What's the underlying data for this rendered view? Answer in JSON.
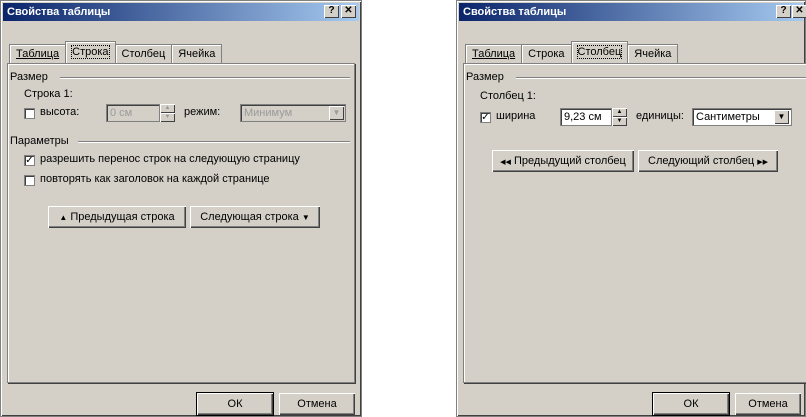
{
  "left": {
    "title": "Свойства таблицы",
    "help_label": "?",
    "close_label": "✕",
    "tabs": [
      "Таблица",
      "Строка",
      "Столбец",
      "Ячейка"
    ],
    "active_tab": "Строка",
    "size_group": "Размер",
    "row_label": "Строка 1:",
    "height_label": "высота:",
    "height_value": "0 см",
    "mode_label": "режим:",
    "mode_value": "Минимум",
    "params_group": "Параметры",
    "option_1": "разрешить перенос строк на следующую страницу",
    "option_1_checked": true,
    "option_2": "повторять как заголовок на каждой странице",
    "option_2_checked": false,
    "prev_button": "Предыдущая строка",
    "next_button": "Следующая строка",
    "prev_arrow": "▲",
    "next_arrow": "▼",
    "ok": "ОК",
    "cancel": "Отмена"
  },
  "right": {
    "title": "Свойства таблицы",
    "help_label": "?",
    "close_label": "✕",
    "tabs": [
      "Таблица",
      "Строка",
      "Столбец",
      "Ячейка"
    ],
    "active_tab": "Столбец",
    "size_group": "Размер",
    "col_label": "Столбец 1:",
    "width_label": "ширина",
    "width_checked": true,
    "width_value": "9,23 см",
    "units_label": "единицы:",
    "units_value": "Сантиметры",
    "prev_button": "Предыдущий столбец",
    "next_button": "Следующий столбец",
    "prev_arrow": "◀◀",
    "next_arrow": "▶▶",
    "ok": "ОК",
    "cancel": "Отмена"
  }
}
